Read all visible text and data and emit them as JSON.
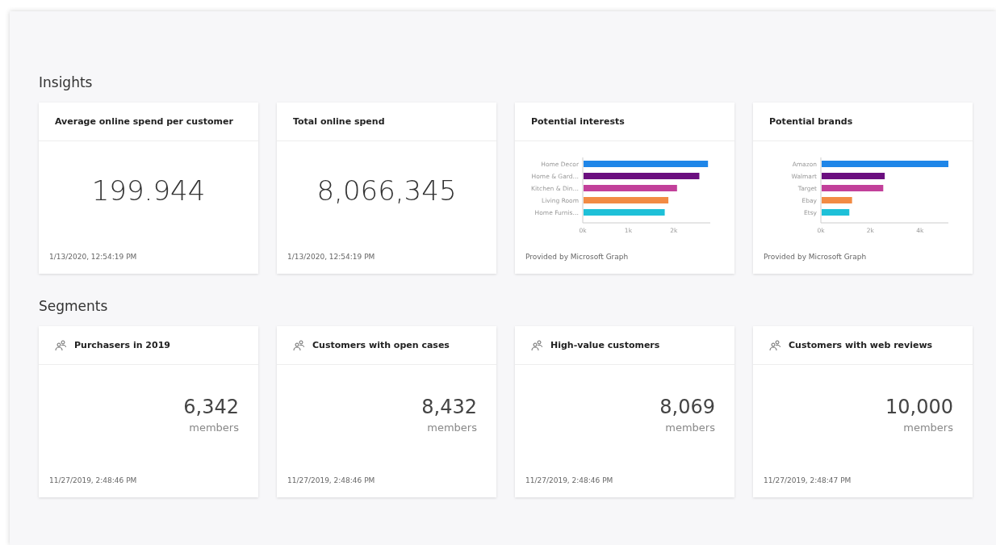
{
  "insights": {
    "title": "Insights",
    "cards": [
      {
        "kind": "number",
        "title": "Average online spend per customer",
        "value": "199.944",
        "timestamp": "1/13/2020, 12:54:19 PM"
      },
      {
        "kind": "number",
        "title": "Total online spend",
        "value": "8,066,345",
        "timestamp": "1/13/2020, 12:54:19 PM"
      },
      {
        "kind": "chart",
        "title": "Potential interests",
        "footer": "Provided by Microsoft Graph",
        "chart_data": {
          "type": "bar",
          "orientation": "horizontal",
          "stacked": true,
          "xlim": [
            0,
            2.8
          ],
          "xticks": [
            {
              "value": 0,
              "label": "0k"
            },
            {
              "value": 1,
              "label": "1k"
            },
            {
              "value": 2,
              "label": "2k"
            }
          ],
          "series": [
            {
              "name": "Home Decor",
              "color": "#1f86e8",
              "values": [
                2.75,
                null,
                null,
                null,
                null
              ]
            },
            {
              "name": "Home & Gard…",
              "color": "#6b0f7f",
              "values": [
                null,
                2.56,
                null,
                null,
                null
              ]
            },
            {
              "name": "Kitchen & Din…",
              "color": "#c2409a",
              "values": [
                null,
                null,
                2.07,
                null,
                null
              ]
            },
            {
              "name": "Living Room",
              "color": "#f28b44",
              "values": [
                null,
                null,
                null,
                1.88,
                null
              ]
            },
            {
              "name": "Home Furnis…",
              "color": "#1ec0d8",
              "values": [
                null,
                null,
                null,
                null,
                1.8
              ]
            }
          ]
        }
      },
      {
        "kind": "chart",
        "title": "Potential brands",
        "footer": "Provided by Microsoft Graph",
        "chart_data": {
          "type": "bar",
          "orientation": "horizontal",
          "stacked": true,
          "xlim": [
            0,
            5.15
          ],
          "xticks": [
            {
              "value": 0,
              "label": "0k"
            },
            {
              "value": 2,
              "label": "2k"
            },
            {
              "value": 4,
              "label": "4k"
            }
          ],
          "series": [
            {
              "name": "Amazon",
              "color": "#1f86e8",
              "values": [
                5.15,
                null,
                null,
                null,
                null
              ]
            },
            {
              "name": "Walmart",
              "color": "#6b0f7f",
              "values": [
                null,
                2.58,
                null,
                null,
                null
              ]
            },
            {
              "name": "Target",
              "color": "#c2409a",
              "values": [
                null,
                null,
                2.52,
                null,
                null
              ]
            },
            {
              "name": "Ebay",
              "color": "#f28b44",
              "values": [
                null,
                null,
                null,
                1.26,
                null
              ]
            },
            {
              "name": "Etsy",
              "color": "#1ec0d8",
              "values": [
                null,
                null,
                null,
                null,
                1.15
              ]
            }
          ]
        }
      }
    ]
  },
  "segments": {
    "title": "Segments",
    "cards": [
      {
        "title": "Purchasers in 2019",
        "count": "6,342",
        "unit": "members",
        "timestamp": "11/27/2019, 2:48:46 PM"
      },
      {
        "title": "Customers with open cases",
        "count": "8,432",
        "unit": "members",
        "timestamp": "11/27/2019, 2:48:46 PM"
      },
      {
        "title": "High-value customers",
        "count": "8,069",
        "unit": "members",
        "timestamp": "11/27/2019, 2:48:46 PM"
      },
      {
        "title": "Customers with web reviews",
        "count": "10,000",
        "unit": "members",
        "timestamp": "11/27/2019, 2:48:47 PM"
      }
    ]
  }
}
